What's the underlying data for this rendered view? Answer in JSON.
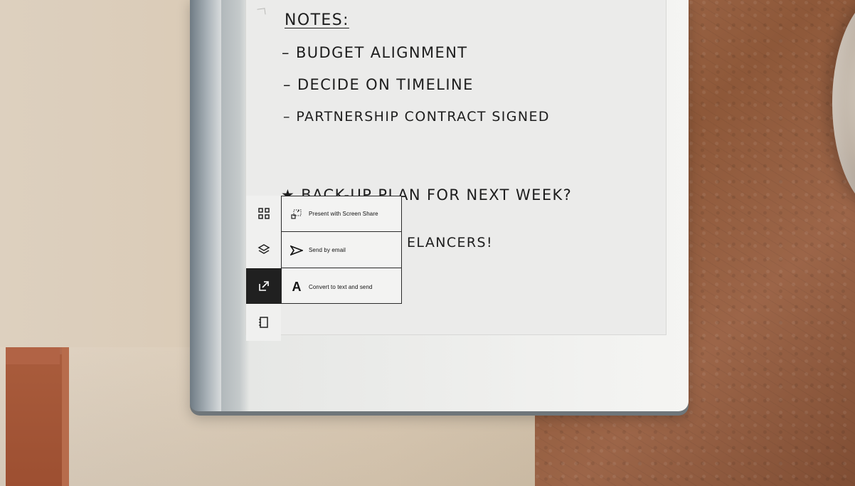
{
  "notes": {
    "heading": "NOTES:",
    "items": [
      "– BUDGET ALIGNMENT",
      "– DECIDE ON TIMELINE",
      "– PARTNERSHIP CONTRACT SIGNED",
      "★ BACK-UP PLAN FOR NEXT WEEK?",
      "ELANCERS!"
    ]
  },
  "toolbar": {
    "items": [
      {
        "icon": "grid-icon"
      },
      {
        "icon": "layers-icon"
      },
      {
        "icon": "share-icon"
      },
      {
        "icon": "notebook-icon"
      }
    ]
  },
  "share_menu": {
    "items": [
      {
        "label": "Present with Screen Share",
        "icon": "screen-share-icon"
      },
      {
        "label": "Send by email",
        "icon": "send-icon"
      },
      {
        "label": "Convert to text and send",
        "icon": "text-convert-icon"
      }
    ]
  }
}
